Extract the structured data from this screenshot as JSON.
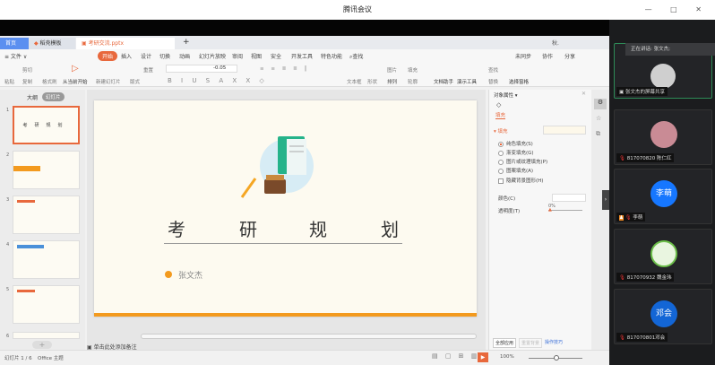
{
  "window": {
    "title": "腾讯会议",
    "controls": "— □ ✕"
  },
  "wps": {
    "tabs": [
      {
        "label": "首页"
      },
      {
        "label": "稻壳模板"
      },
      {
        "label": "考研交流.pptx"
      }
    ],
    "new_tab": "+",
    "user": "秋.",
    "menu_file": "≡ 文件 ∨",
    "menus": [
      "开始",
      "插入",
      "设计",
      "切换",
      "动画",
      "幻灯片放映",
      "审阅",
      "视图",
      "安全",
      "开发工具",
      "特色功能"
    ],
    "search": "查找",
    "right_actions": [
      "未同步",
      "协作",
      "分享"
    ],
    "toolbar": {
      "paste": "粘贴",
      "cut": "剪切",
      "copy": "复制",
      "format_painter": "格式刷",
      "play_from": "从当前开始",
      "new_slide": "新建幻灯片",
      "layout": "版式",
      "reset": "重置",
      "font_size": "-0.05",
      "text_box": "文本框",
      "shape": "形状",
      "picture": "图片",
      "fill": "填充",
      "arrange": "排列",
      "outline": "轮廓",
      "doc_helper": "文档助手",
      "present_tools": "演示工具",
      "find": "查找",
      "replace": "替换",
      "select_pane": "选择窗格"
    },
    "left_tabs": {
      "outline": "大纲",
      "slides": "幻灯片"
    },
    "slide_numbers": [
      "1",
      "2",
      "3",
      "4",
      "5",
      "6"
    ],
    "slide": {
      "title_chars": [
        "考",
        "研",
        "规",
        "划"
      ],
      "author": "张文杰"
    },
    "notes_placeholder": "单击此处添加备注",
    "props": {
      "header": "对象属性 ▾",
      "tab": "填充",
      "fill_label": "填充",
      "options": [
        "纯色填充(S)",
        "渐变填充(G)",
        "图片或纹理填充(P)",
        "图案填充(A)"
      ],
      "hide_bg": "隐藏背景图形(H)",
      "color_label": "颜色(C)",
      "transparency_label": "透明度(T)",
      "transparency_value": "0%",
      "apply_all": "全部应用",
      "reset_bg": "重置背景",
      "tips": "操作技巧"
    },
    "status": {
      "slide_count": "幻灯片 1 / 6",
      "theme": "Office 主题",
      "zoom": "100%"
    },
    "accent": "#e8683c"
  },
  "meeting": {
    "speaking": "正在讲话: 张文杰;",
    "participants": [
      {
        "name": "张文杰的屏幕共享",
        "avatar_text": "",
        "color": "#cfcfcf"
      },
      {
        "name": "817070820 陈仁红",
        "avatar_text": "",
        "color": "#c98b95"
      },
      {
        "name": "李萌",
        "avatar_text": "李萌",
        "color": "#1677ff"
      },
      {
        "name": "817070932 魏金玮",
        "avatar_text": "",
        "color": "#e9f5e0"
      },
      {
        "name": "817070801邓会",
        "avatar_text": "邓会",
        "color": "#1366d6"
      }
    ]
  }
}
